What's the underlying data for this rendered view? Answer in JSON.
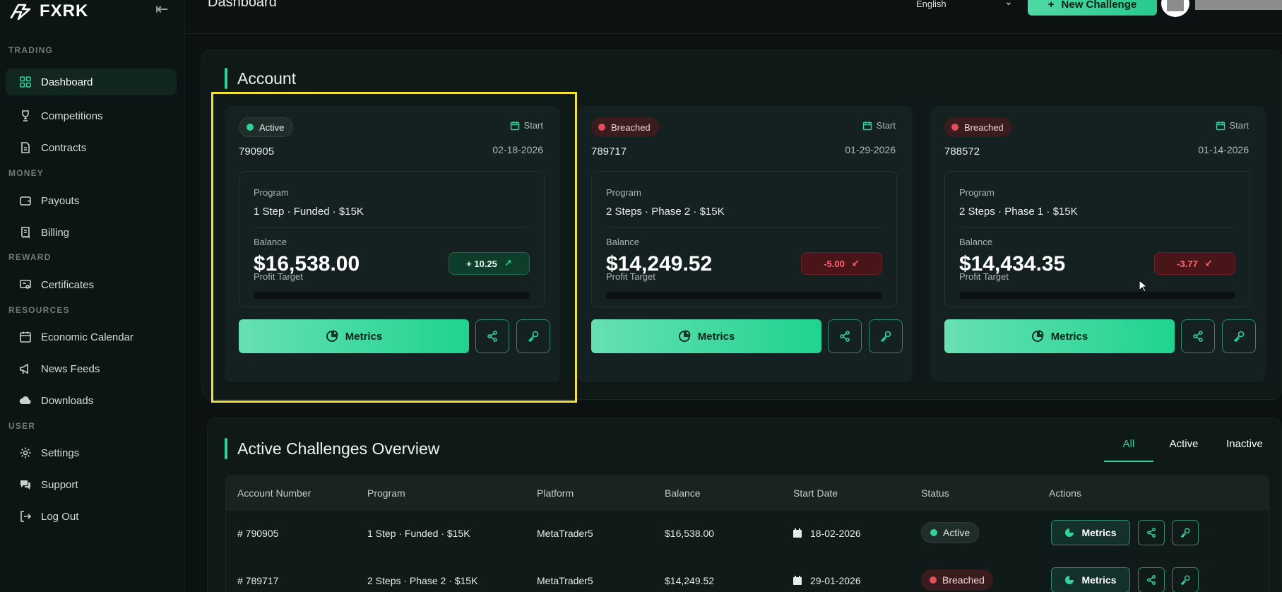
{
  "brand": {
    "name": "FXRK"
  },
  "sidebar": {
    "sections": [
      {
        "label": "TRADING"
      },
      {
        "label": "MONEY"
      },
      {
        "label": "REWARD"
      },
      {
        "label": "RESOURCES"
      },
      {
        "label": "USER"
      }
    ],
    "items": [
      {
        "label": "Dashboard",
        "icon": "grid-icon",
        "active": true
      },
      {
        "label": "Competitions",
        "icon": "trophy-icon"
      },
      {
        "label": "Contracts",
        "icon": "document-icon"
      },
      {
        "label": "Payouts",
        "icon": "wallet-icon"
      },
      {
        "label": "Billing",
        "icon": "receipt-icon"
      },
      {
        "label": "Certificates",
        "icon": "certificate-icon"
      },
      {
        "label": "Economic Calendar",
        "icon": "calendar-icon"
      },
      {
        "label": "News Feeds",
        "icon": "megaphone-icon"
      },
      {
        "label": "Downloads",
        "icon": "cloud-download-icon"
      },
      {
        "label": "Settings",
        "icon": "gear-icon"
      },
      {
        "label": "Support",
        "icon": "chat-icon"
      },
      {
        "label": "Log Out",
        "icon": "logout-icon"
      }
    ]
  },
  "header": {
    "title": "Dashboard",
    "language": "English",
    "new_challenge": "New Challenge"
  },
  "account": {
    "title": "Account",
    "start_label": "Start",
    "program_label": "Program",
    "balance_label": "Balance",
    "profit_target_label": "Profit Target",
    "metrics_label": "Metrics",
    "cards": [
      {
        "status": "Active",
        "number": "790905",
        "date": "02-18-2026",
        "program": "1 Step · Funded · $15K",
        "balance": "$16,538.00",
        "change": "+ 10.25",
        "direction": "up"
      },
      {
        "status": "Breached",
        "number": "789717",
        "date": "01-29-2026",
        "program": "2 Steps · Phase 2 · $15K",
        "balance": "$14,249.52",
        "change": "-5.00",
        "direction": "down"
      },
      {
        "status": "Breached",
        "number": "788572",
        "date": "01-14-2026",
        "program": "2 Steps · Phase 1 · $15K",
        "balance": "$14,434.35",
        "change": "-3.77",
        "direction": "down"
      }
    ]
  },
  "overview": {
    "title": "Active Challenges Overview",
    "tabs": [
      "All",
      "Active",
      "Inactive"
    ],
    "columns": [
      "Account Number",
      "Program",
      "Platform",
      "Balance",
      "Start Date",
      "Status",
      "Actions"
    ],
    "metrics_label": "Metrics",
    "rows": [
      {
        "account": "# 790905",
        "program": "1 Step · Funded · $15K",
        "platform": "MetaTrader5",
        "balance": "$16,538.00",
        "start": "18-02-2026",
        "status": "Active"
      },
      {
        "account": "# 789717",
        "program": "2 Steps · Phase 2 · $15K",
        "platform": "MetaTrader5",
        "balance": "$14,249.52",
        "start": "29-01-2026",
        "status": "Breached"
      }
    ]
  },
  "colors": {
    "accent": "#2fd49a",
    "danger": "#e0505a",
    "highlight": "#f1e23a",
    "background": "#0b1211"
  }
}
